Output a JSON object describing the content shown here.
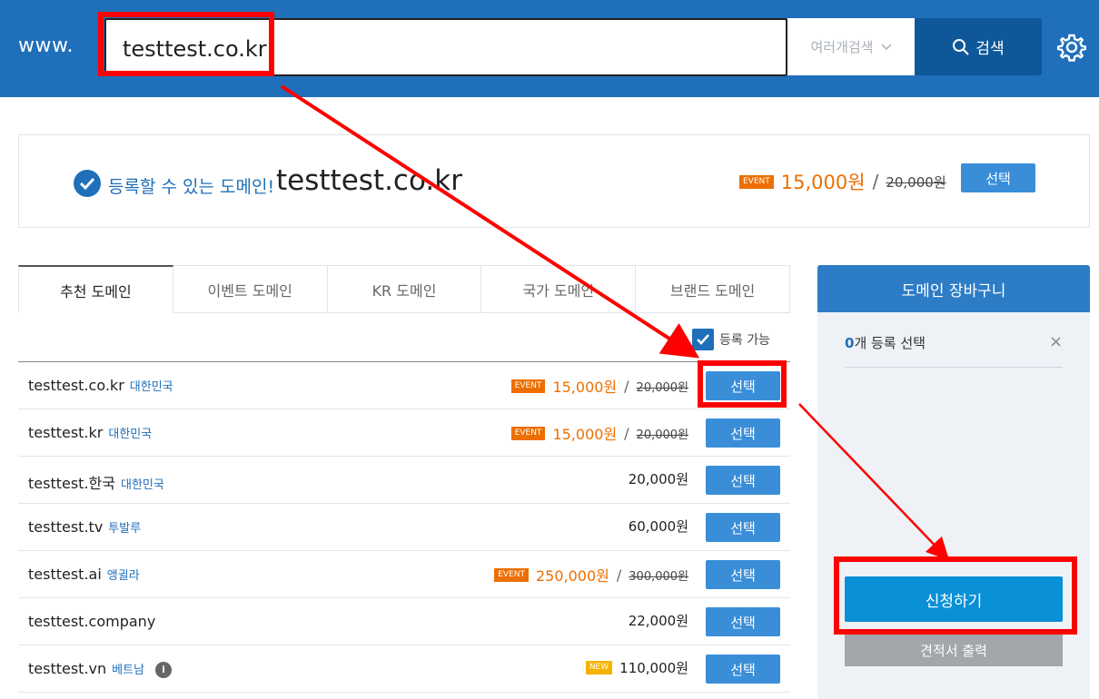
{
  "header": {
    "prefix": "www.",
    "search_value": "testtest.co.kr",
    "multi_search_label": "여러개검색",
    "search_button_label": "검색"
  },
  "result": {
    "available_label": "등록할 수 있는 도메인!",
    "domain": "testtest.co.kr",
    "badge": "EVENT",
    "price": "15,000원",
    "separator": "/",
    "original_price": "20,000원",
    "select_label": "선택"
  },
  "tabs": [
    {
      "label": "추천 도메인",
      "active": true
    },
    {
      "label": "이벤트 도메인",
      "active": false
    },
    {
      "label": "KR 도메인",
      "active": false
    },
    {
      "label": "국가 도메인",
      "active": false
    },
    {
      "label": "브랜드 도메인",
      "active": false
    }
  ],
  "filter": {
    "label": "등록 가능",
    "checked": true
  },
  "list": {
    "separator": "/",
    "select_label": "선택",
    "rows": [
      {
        "name": "testtest.co.kr",
        "country": "대한민국",
        "badge": "EVENT",
        "price": "15,000원",
        "original": "20,000원"
      },
      {
        "name": "testtest.kr",
        "country": "대한민국",
        "badge": "EVENT",
        "price": "15,000원",
        "original": "20,000원"
      },
      {
        "name": "testtest.한국",
        "country": "대한민국",
        "price": "20,000원"
      },
      {
        "name": "testtest.tv",
        "country": "투발루",
        "price": "60,000원"
      },
      {
        "name": "testtest.ai",
        "country": "앵귈라",
        "badge": "EVENT",
        "price": "250,000원",
        "original": "300,000원"
      },
      {
        "name": "testtest.company",
        "country": "",
        "price": "22,000원"
      },
      {
        "name": "testtest.vn",
        "country": "베트남",
        "info": "i",
        "badge": "NEW",
        "price": "110,000원"
      }
    ]
  },
  "cart": {
    "title": "도메인 장바구니",
    "count": "0",
    "count_suffix": "개 등록 선택",
    "close": "×",
    "apply_label": "신청하기",
    "quote_label": "견적서 출력"
  },
  "colors": {
    "brand": "#1f6fba",
    "event": "#ec6f00",
    "highlight": "#ff0000",
    "button": "#3a8ed8"
  }
}
